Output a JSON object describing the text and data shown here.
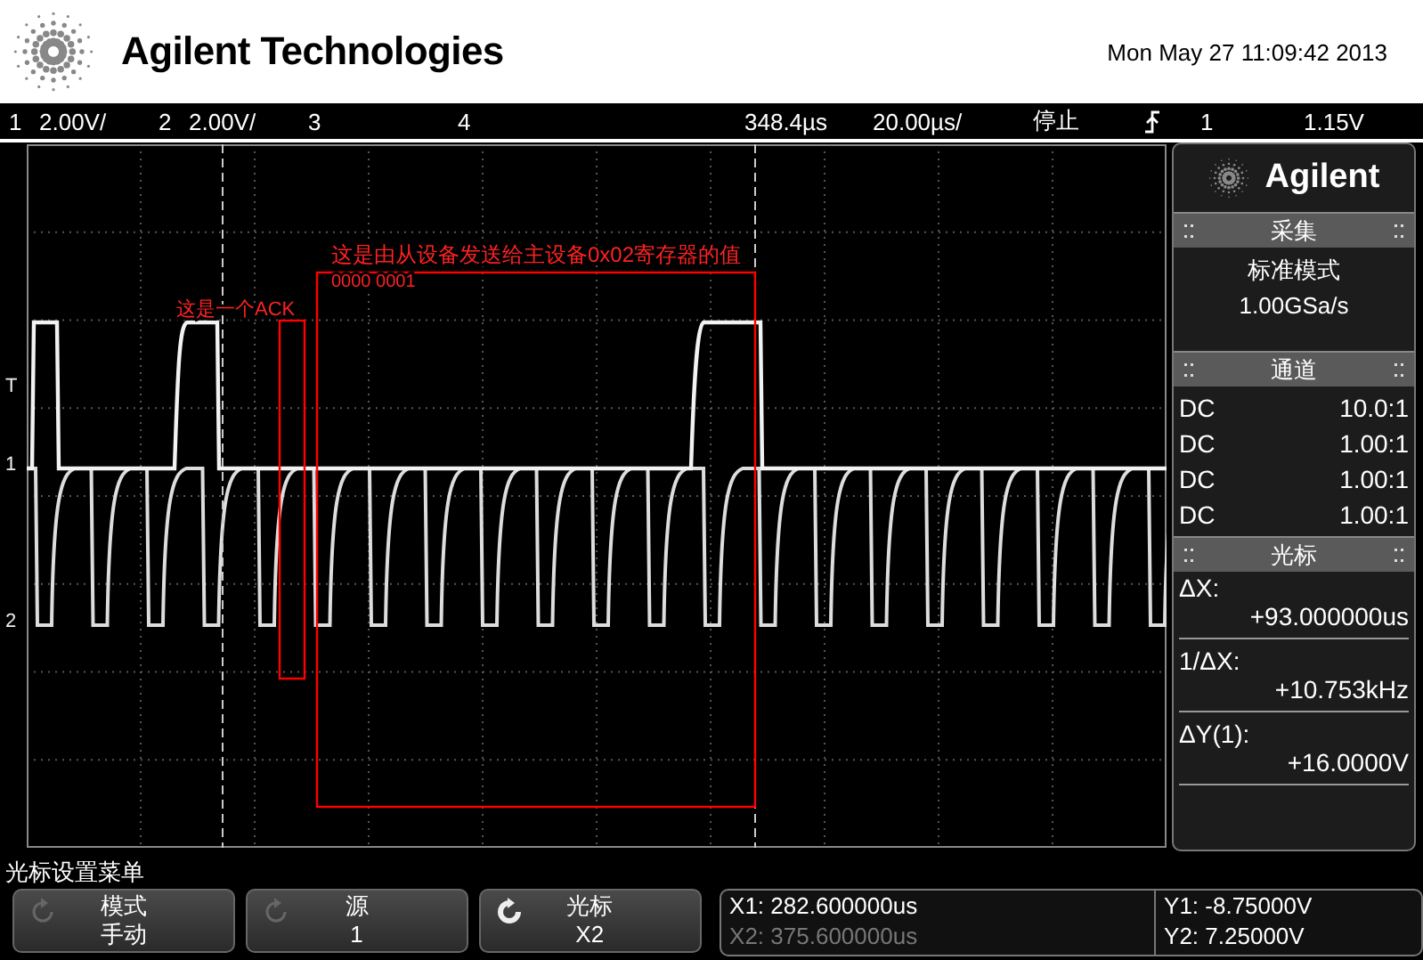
{
  "header": {
    "brand": "Agilent Technologies",
    "datetime": "Mon May 27 11:09:42 2013"
  },
  "status_bar": {
    "channels": [
      {
        "number": "1",
        "scale": "2.00V/"
      },
      {
        "number": "2",
        "scale": "2.00V/"
      },
      {
        "number": "3"
      },
      {
        "number": "4"
      }
    ],
    "delay": "348.4µs",
    "timebase": "20.00µs/",
    "run_state": "停止",
    "trigger_source": "1",
    "trigger_level": "1.15V"
  },
  "scope": {
    "markers": [
      {
        "label": "T"
      },
      {
        "label": "1"
      },
      {
        "label": "2"
      }
    ],
    "annotations": [
      {
        "text": "这是由从设备发送给主设备0x02寄存器的值"
      },
      {
        "text": "0000 0001"
      },
      {
        "text": "这是一个ACK"
      }
    ]
  },
  "side_panel": {
    "brand": "Agilent",
    "acquisition": {
      "title": "采集",
      "mode": "标准模式",
      "rate": "1.00GSa/s"
    },
    "channels": {
      "title": "通道",
      "rows": [
        {
          "coupling": "DC",
          "probe": "10.0:1"
        },
        {
          "coupling": "DC",
          "probe": "1.00:1"
        },
        {
          "coupling": "DC",
          "probe": "1.00:1"
        },
        {
          "coupling": "DC",
          "probe": "1.00:1"
        }
      ]
    },
    "cursors": {
      "title": "光标",
      "measurements": [
        {
          "name": "ΔX:",
          "reading": "+93.000000us"
        },
        {
          "name": "1/ΔX:",
          "reading": "+10.753kHz"
        },
        {
          "name": "ΔY(1):",
          "reading": "+16.0000V"
        }
      ]
    }
  },
  "menu": {
    "title": "光标设置菜单",
    "softkeys": [
      {
        "label": "模式",
        "value": "手动",
        "knob_active": false
      },
      {
        "label": "源",
        "value": "1",
        "knob_active": false
      },
      {
        "label": "光标",
        "value": "X2",
        "knob_active": true
      }
    ],
    "readouts": [
      {
        "text": "X1: 282.600000us",
        "dimmed": false
      },
      {
        "text": "X2: 375.600000us",
        "dimmed": true
      },
      {
        "text": "Y1: -8.75000V",
        "dimmed": false
      },
      {
        "text": "Y2: 7.25000V",
        "dimmed": false
      }
    ]
  }
}
